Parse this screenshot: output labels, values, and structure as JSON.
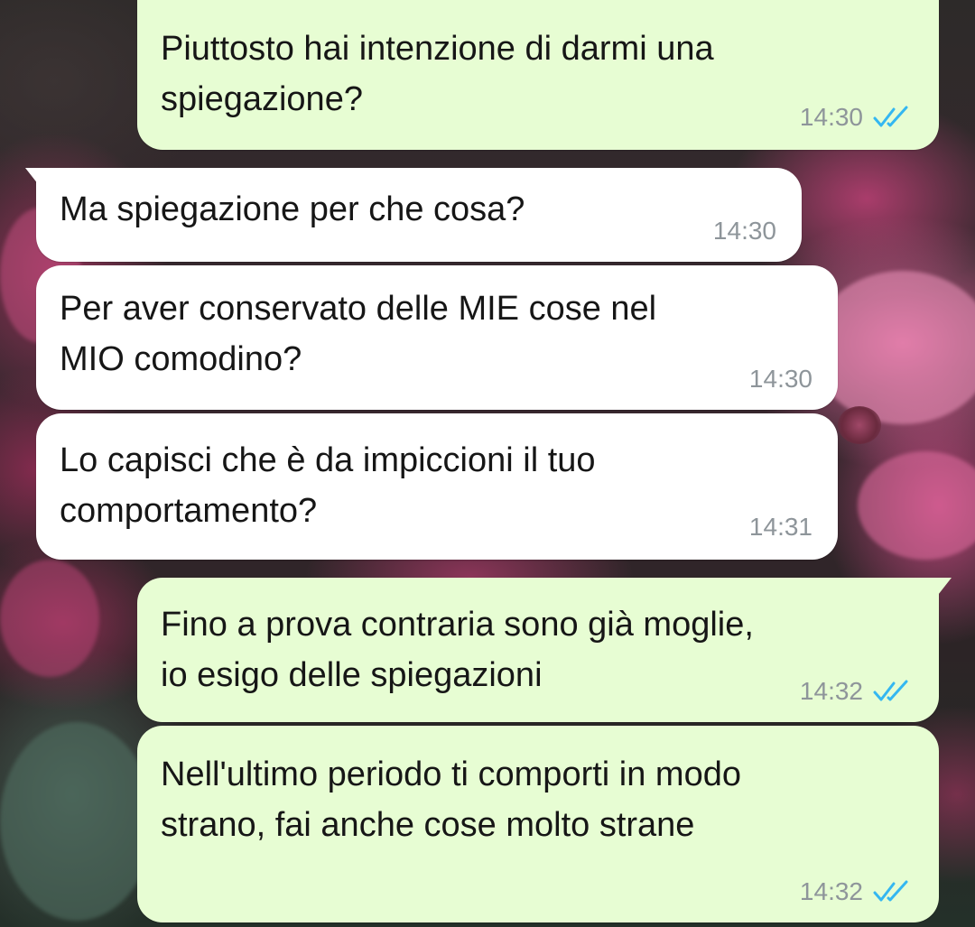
{
  "colors": {
    "outgoing_bubble": "#e7fdd3",
    "incoming_bubble": "#ffffff",
    "read_ticks": "#34b7f1",
    "timestamp": "#8e959a"
  },
  "icons": {
    "read_receipt": "double-check-icon"
  },
  "messages": [
    {
      "direction": "outgoing",
      "text": "Piuttosto hai intenzione di darmi una\nspiegazione?",
      "time": "14:30",
      "status": "read"
    },
    {
      "direction": "incoming",
      "text": "Ma spiegazione per che cosa?",
      "time": "14:30"
    },
    {
      "direction": "incoming",
      "text": "Per aver conservato delle MIE cose nel\nMIO comodino?",
      "time": "14:30"
    },
    {
      "direction": "incoming",
      "text": "Lo capisci che è da impiccioni il tuo\ncomportamento?",
      "time": "14:31"
    },
    {
      "direction": "outgoing",
      "text": "Fino a prova contraria sono già moglie,\nio esigo delle spiegazioni",
      "time": "14:32",
      "status": "read"
    },
    {
      "direction": "outgoing",
      "text": "Nell'ultimo periodo ti comporti in modo\nstrano, fai anche cose molto strane",
      "time": "14:32",
      "status": "read"
    }
  ]
}
